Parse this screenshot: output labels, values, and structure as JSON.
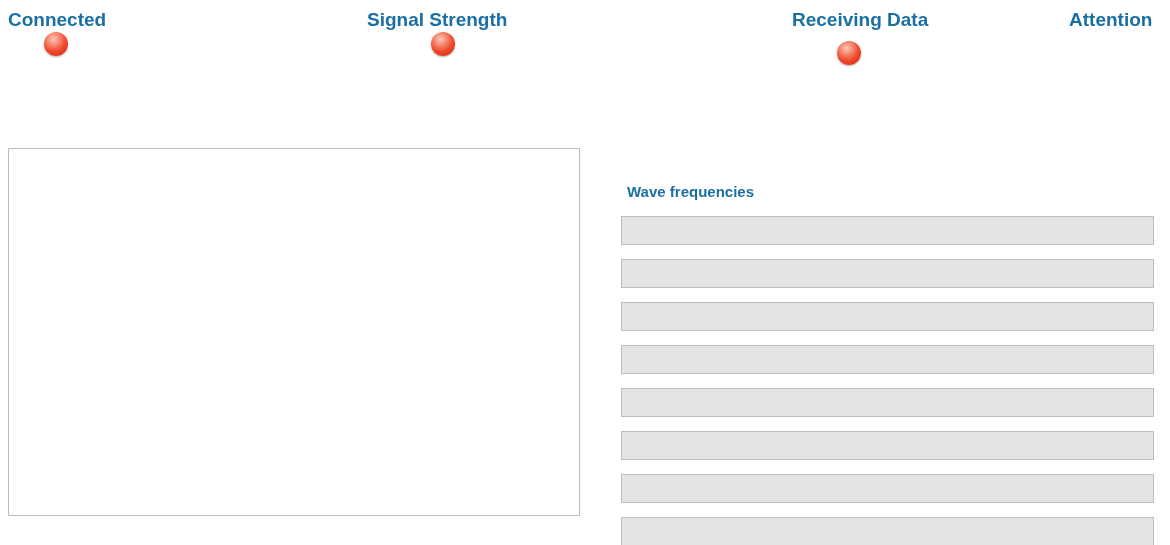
{
  "indicators": [
    {
      "label": "Connected",
      "kind": "light",
      "on": false
    },
    {
      "label": "Signal Strength",
      "kind": "light",
      "on": false
    },
    {
      "label": "Receiving Data",
      "kind": "light",
      "on": false
    },
    {
      "label": "Attention",
      "kind": "label"
    }
  ],
  "wave_frequencies": {
    "title": "Wave frequencies",
    "bars": [
      {
        "level": 0
      },
      {
        "level": 0
      },
      {
        "level": 0
      },
      {
        "level": 0
      },
      {
        "level": 0
      },
      {
        "level": 0
      },
      {
        "level": 0
      },
      {
        "level": 0
      }
    ]
  }
}
